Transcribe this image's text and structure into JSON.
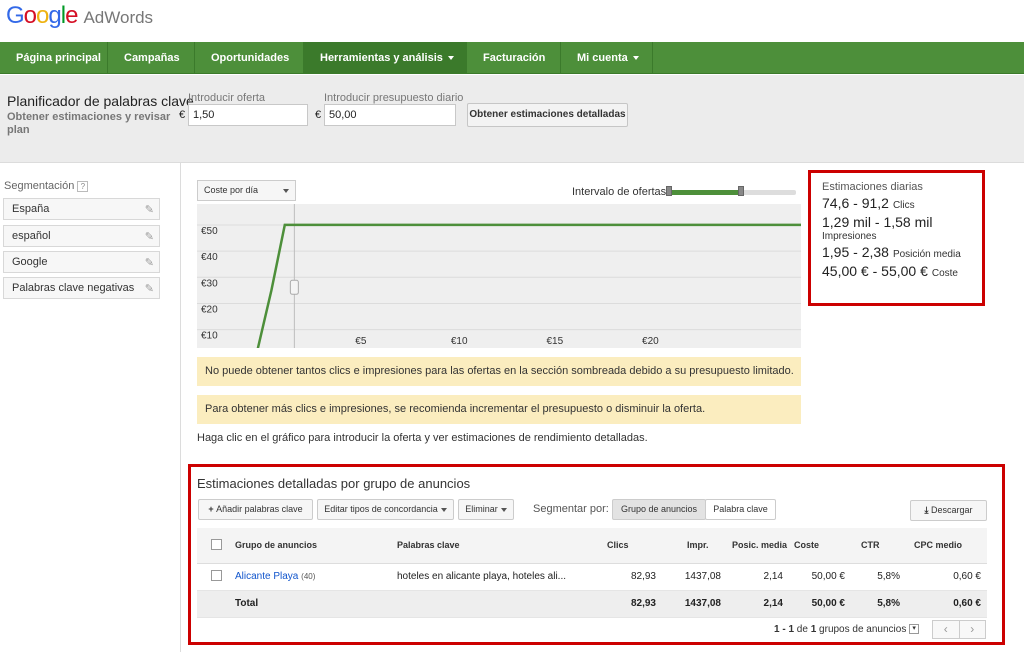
{
  "header": {
    "logo_letters": [
      "G",
      "o",
      "o",
      "g",
      "l",
      "e"
    ],
    "product": "AdWords"
  },
  "nav": {
    "items": [
      {
        "label": "Página principal"
      },
      {
        "label": "Campañas"
      },
      {
        "label": "Oportunidades"
      },
      {
        "label": "Herramientas y análisis",
        "dropdown": true,
        "active": true
      },
      {
        "label": "Facturación"
      },
      {
        "label": "Mi cuenta",
        "dropdown": true
      }
    ]
  },
  "planner": {
    "title": "Planificador de palabras clave",
    "subtitle": "Obtener estimaciones y revisar plan",
    "bid_label": "Introducir oferta",
    "bid_currency": "€",
    "bid_value": "1,50",
    "budget_label": "Introducir presupuesto diario",
    "budget_currency": "€",
    "budget_value": "50,00",
    "detail_button": "Obtener estimaciones detalladas"
  },
  "segmentation": {
    "title": "Segmentación",
    "help": "?",
    "items": [
      "España",
      "español",
      "Google",
      "Palabras clave negativas"
    ]
  },
  "chart": {
    "metric_select": "Coste por día",
    "range_label": "Intervalo de ofertas",
    "range": {
      "low_fraction": 0.0,
      "high_fraction": 0.55
    }
  },
  "chart_data": {
    "type": "line",
    "series": [
      {
        "values": [
          [
            -0.5,
            0
          ],
          [
            0.3,
            25
          ],
          [
            1.0,
            50
          ],
          [
            28,
            50
          ]
        ]
      }
    ],
    "x_ticks": [
      "€5",
      "€10",
      "€15",
      "€20"
    ],
    "x_tick_values": [
      5,
      10,
      15,
      20
    ],
    "y_ticks": [
      "€10",
      "€20",
      "€30",
      "€40",
      "€50"
    ],
    "y_tick_values": [
      10,
      20,
      30,
      40,
      50
    ],
    "xlim": [
      -1.5,
      28
    ],
    "ylim": [
      3,
      58
    ],
    "grid": true,
    "line_color": "#4d8f3a",
    "current_bid": 1.5
  },
  "notices": [
    "No puede obtener tantos clics e impresiones para las ofertas en la sección sombreada debido a su presupuesto limitado.",
    "Para obtener más clics e impresiones, se recomienda incrementar el presupuesto o disminuir la oferta."
  ],
  "help_text": "Haga clic en el gráfico para introducir la oferta y ver estimaciones de rendimiento detalladas.",
  "daily": {
    "title": "Estimaciones diarias",
    "clicks": "74,6 - 91,2",
    "clicks_label": "Clics",
    "impressions": "1,29 mil - 1,58 mil",
    "impressions_label": "Impresiones",
    "position": "1,95 - 2,38",
    "position_label": "Posición media",
    "cost": "45,00 € - 55,00 €",
    "cost_label": "Coste"
  },
  "details": {
    "title": "Estimaciones detalladas por grupo de anuncios",
    "add_keywords": "Añadir palabras clave",
    "edit_match": "Editar tipos de concordancia",
    "delete": "Eliminar",
    "segment_label": "Segmentar por:",
    "segment_options": [
      "Grupo de anuncios",
      "Palabra clave"
    ],
    "download": "Descargar",
    "columns": [
      "Grupo de anuncios",
      "Palabras clave",
      "Clics",
      "Impr.",
      "Posic. media",
      "Coste",
      "CTR",
      "CPC medio"
    ],
    "row": {
      "group": "Alicante Playa",
      "count": "(40)",
      "keywords": "hoteles en alicante playa, hoteles ali...",
      "clicks": "82,93",
      "impr": "1437,08",
      "pos": "2,14",
      "cost": "50,00 €",
      "ctr": "5,8%",
      "cpc": "0,60 €"
    },
    "total": {
      "label": "Total",
      "clicks": "82,93",
      "impr": "1437,08",
      "pos": "2,14",
      "cost": "50,00 €",
      "ctr": "5,8%",
      "cpc": "0,60 €"
    },
    "pager_range": "1 - 1",
    "pager_of": "de",
    "pager_total": "1",
    "pager_label": "grupos de anuncios"
  }
}
